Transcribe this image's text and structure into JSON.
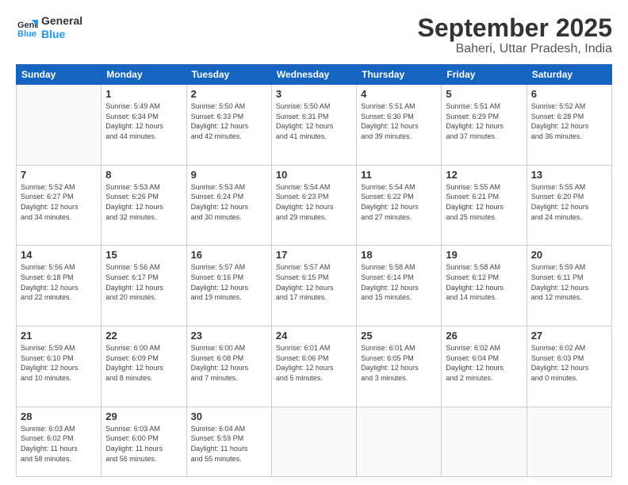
{
  "logo": {
    "line1": "General",
    "line2": "Blue"
  },
  "title": "September 2025",
  "location": "Baheri, Uttar Pradesh, India",
  "weekdays": [
    "Sunday",
    "Monday",
    "Tuesday",
    "Wednesday",
    "Thursday",
    "Friday",
    "Saturday"
  ],
  "weeks": [
    [
      {
        "day": "",
        "info": ""
      },
      {
        "day": "1",
        "info": "Sunrise: 5:49 AM\nSunset: 6:34 PM\nDaylight: 12 hours\nand 44 minutes."
      },
      {
        "day": "2",
        "info": "Sunrise: 5:50 AM\nSunset: 6:33 PM\nDaylight: 12 hours\nand 42 minutes."
      },
      {
        "day": "3",
        "info": "Sunrise: 5:50 AM\nSunset: 6:31 PM\nDaylight: 12 hours\nand 41 minutes."
      },
      {
        "day": "4",
        "info": "Sunrise: 5:51 AM\nSunset: 6:30 PM\nDaylight: 12 hours\nand 39 minutes."
      },
      {
        "day": "5",
        "info": "Sunrise: 5:51 AM\nSunset: 6:29 PM\nDaylight: 12 hours\nand 37 minutes."
      },
      {
        "day": "6",
        "info": "Sunrise: 5:52 AM\nSunset: 6:28 PM\nDaylight: 12 hours\nand 36 minutes."
      }
    ],
    [
      {
        "day": "7",
        "info": "Sunrise: 5:52 AM\nSunset: 6:27 PM\nDaylight: 12 hours\nand 34 minutes."
      },
      {
        "day": "8",
        "info": "Sunrise: 5:53 AM\nSunset: 6:26 PM\nDaylight: 12 hours\nand 32 minutes."
      },
      {
        "day": "9",
        "info": "Sunrise: 5:53 AM\nSunset: 6:24 PM\nDaylight: 12 hours\nand 30 minutes."
      },
      {
        "day": "10",
        "info": "Sunrise: 5:54 AM\nSunset: 6:23 PM\nDaylight: 12 hours\nand 29 minutes."
      },
      {
        "day": "11",
        "info": "Sunrise: 5:54 AM\nSunset: 6:22 PM\nDaylight: 12 hours\nand 27 minutes."
      },
      {
        "day": "12",
        "info": "Sunrise: 5:55 AM\nSunset: 6:21 PM\nDaylight: 12 hours\nand 25 minutes."
      },
      {
        "day": "13",
        "info": "Sunrise: 5:55 AM\nSunset: 6:20 PM\nDaylight: 12 hours\nand 24 minutes."
      }
    ],
    [
      {
        "day": "14",
        "info": "Sunrise: 5:56 AM\nSunset: 6:18 PM\nDaylight: 12 hours\nand 22 minutes."
      },
      {
        "day": "15",
        "info": "Sunrise: 5:56 AM\nSunset: 6:17 PM\nDaylight: 12 hours\nand 20 minutes."
      },
      {
        "day": "16",
        "info": "Sunrise: 5:57 AM\nSunset: 6:16 PM\nDaylight: 12 hours\nand 19 minutes."
      },
      {
        "day": "17",
        "info": "Sunrise: 5:57 AM\nSunset: 6:15 PM\nDaylight: 12 hours\nand 17 minutes."
      },
      {
        "day": "18",
        "info": "Sunrise: 5:58 AM\nSunset: 6:14 PM\nDaylight: 12 hours\nand 15 minutes."
      },
      {
        "day": "19",
        "info": "Sunrise: 5:58 AM\nSunset: 6:12 PM\nDaylight: 12 hours\nand 14 minutes."
      },
      {
        "day": "20",
        "info": "Sunrise: 5:59 AM\nSunset: 6:11 PM\nDaylight: 12 hours\nand 12 minutes."
      }
    ],
    [
      {
        "day": "21",
        "info": "Sunrise: 5:59 AM\nSunset: 6:10 PM\nDaylight: 12 hours\nand 10 minutes."
      },
      {
        "day": "22",
        "info": "Sunrise: 6:00 AM\nSunset: 6:09 PM\nDaylight: 12 hours\nand 8 minutes."
      },
      {
        "day": "23",
        "info": "Sunrise: 6:00 AM\nSunset: 6:08 PM\nDaylight: 12 hours\nand 7 minutes."
      },
      {
        "day": "24",
        "info": "Sunrise: 6:01 AM\nSunset: 6:06 PM\nDaylight: 12 hours\nand 5 minutes."
      },
      {
        "day": "25",
        "info": "Sunrise: 6:01 AM\nSunset: 6:05 PM\nDaylight: 12 hours\nand 3 minutes."
      },
      {
        "day": "26",
        "info": "Sunrise: 6:02 AM\nSunset: 6:04 PM\nDaylight: 12 hours\nand 2 minutes."
      },
      {
        "day": "27",
        "info": "Sunrise: 6:02 AM\nSunset: 6:03 PM\nDaylight: 12 hours\nand 0 minutes."
      }
    ],
    [
      {
        "day": "28",
        "info": "Sunrise: 6:03 AM\nSunset: 6:02 PM\nDaylight: 11 hours\nand 58 minutes."
      },
      {
        "day": "29",
        "info": "Sunrise: 6:03 AM\nSunset: 6:00 PM\nDaylight: 11 hours\nand 56 minutes."
      },
      {
        "day": "30",
        "info": "Sunrise: 6:04 AM\nSunset: 5:59 PM\nDaylight: 11 hours\nand 55 minutes."
      },
      {
        "day": "",
        "info": ""
      },
      {
        "day": "",
        "info": ""
      },
      {
        "day": "",
        "info": ""
      },
      {
        "day": "",
        "info": ""
      }
    ]
  ]
}
